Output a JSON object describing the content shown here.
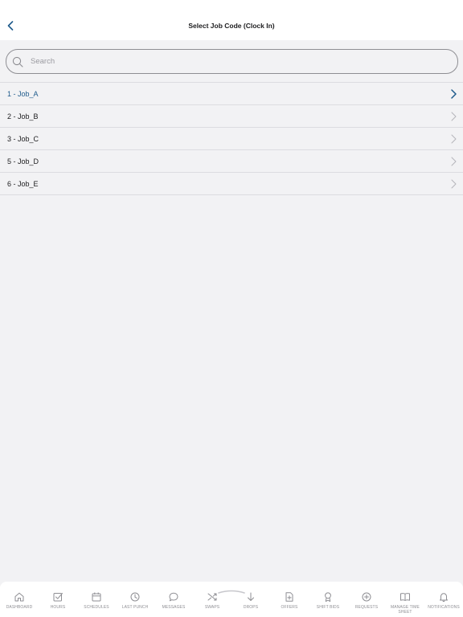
{
  "header": {
    "title": "Select Job Code (Clock In)"
  },
  "search": {
    "placeholder": "Search",
    "value": ""
  },
  "job_codes": [
    {
      "label": "1 - Job_A",
      "selected": true
    },
    {
      "label": "2 - Job_B",
      "selected": false
    },
    {
      "label": "3 - Job_C",
      "selected": false
    },
    {
      "label": "5 - Job_D",
      "selected": false
    },
    {
      "label": "6 - Job_E",
      "selected": false
    }
  ],
  "tabbar": {
    "tabs": [
      {
        "label": "DASHBOARD",
        "icon": "home-icon"
      },
      {
        "label": "HOURS",
        "icon": "checkbox-icon"
      },
      {
        "label": "SCHEDULES",
        "icon": "calendar-icon"
      },
      {
        "label": "LAST PUNCH",
        "icon": "clock-icon"
      },
      {
        "label": "MESSAGES",
        "icon": "chat-bubble-icon"
      },
      {
        "label": "SWAPS",
        "icon": "shuffle-icon"
      },
      {
        "label": "DROPS",
        "icon": "arrow-down-icon"
      },
      {
        "label": "OFFERS",
        "icon": "document-plus-icon"
      },
      {
        "label": "SHIFT BIDS",
        "icon": "award-icon"
      },
      {
        "label": "REQUESTS",
        "icon": "plus-circle-icon"
      },
      {
        "label": "MANAGE TIME SHEET",
        "icon": "book-icon"
      },
      {
        "label": "NOTIFICATIONS",
        "icon": "bell-icon"
      }
    ]
  },
  "colors": {
    "accent": "#1f5b8c",
    "background": "#f2f2f4",
    "tab_icon": "#8e8e93"
  }
}
